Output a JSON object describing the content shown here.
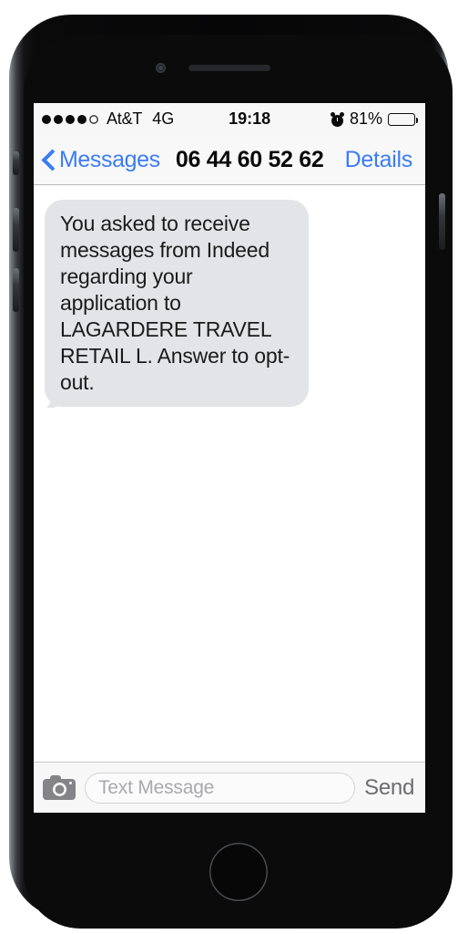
{
  "device": {
    "name": "iPhone",
    "hardware": {
      "earpiece": "earpiece-speaker",
      "front_camera": "front-camera",
      "home_button": "home-button",
      "mute_switch": "mute-switch",
      "volume_up": "volume-up-button",
      "volume_down": "volume-down-button",
      "power": "power-button"
    }
  },
  "status_bar": {
    "signal_dots_total": 5,
    "signal_dots_filled": 4,
    "carrier": "At&T",
    "network": "4G",
    "time": "19:18",
    "alarm_icon": "alarm-clock-icon",
    "battery_percent": "81%",
    "battery_fill_ratio": 0.81
  },
  "nav_bar": {
    "back_icon": "chevron-left-icon",
    "back_label": "Messages",
    "title": "06 44 60 52 62",
    "details_label": "Details"
  },
  "conversation": {
    "messages": [
      {
        "sender": "incoming",
        "text": "You asked to receive messages from Indeed regarding your application to LAGARDERE TRAVEL RETAIL L. Answer to opt-out."
      }
    ]
  },
  "input_bar": {
    "camera_icon": "camera-icon",
    "placeholder": "Text Message",
    "value": "",
    "send_label": "Send"
  },
  "colors": {
    "ios_blue": "#3b7cf5",
    "bubble_gray": "#e3e4e8",
    "bar_gray": "#f7f7f7",
    "send_gray": "#6c6c70",
    "placeholder_gray": "#a9a9ae"
  }
}
